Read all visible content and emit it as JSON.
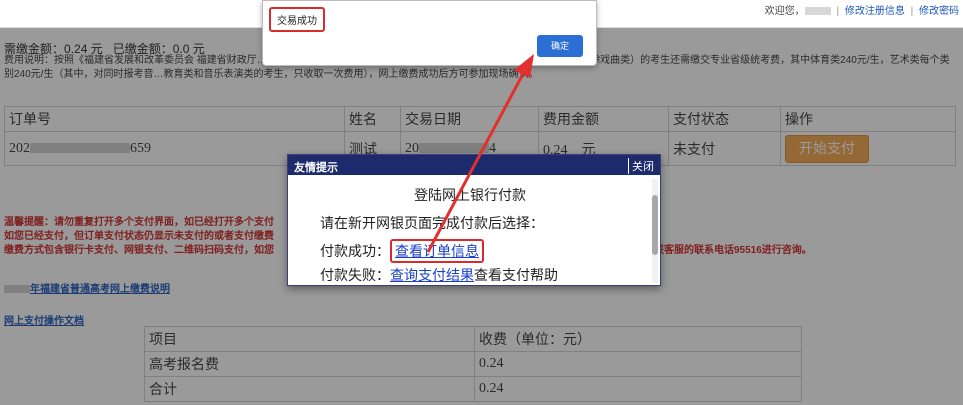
{
  "top": {
    "welcome": "欢迎您，",
    "link_modify_info": "修改注册信息",
    "link_modify_pwd": "修改密码"
  },
  "summary": {
    "due_label": "需缴金额：",
    "due_value": "0.24 元",
    "paid_label": "已缴金额：",
    "paid_value": "0.0 元"
  },
  "fee_note": "费用说明：按照《福建省发展和改革委员会 福建省财政厅……238号）规定，通过网络缴交报名考试费240元，报考体育类、艺术类（除戏曲类）的考生还需缴交专业省级统考费，其中体育类240元/生，艺术类每个类别240元/生（其中，对同时报考音…教育类和音乐表演类的考生，只收取一次费用），网上缴费成功后方可参加现场确认。",
  "orders": {
    "headers": [
      "订单号",
      "姓名",
      "交易日期",
      "费用金额",
      "支付状态",
      "操作"
    ],
    "row": {
      "order_prefix": "202",
      "order_suffix": "659",
      "name": "测试",
      "date_prefix": "20",
      "date_suffix": "4",
      "amount": "0.24",
      "unit": "元",
      "status": "未支付",
      "action": "开始支付"
    }
  },
  "warning": {
    "line1": "温馨提醒：请勿重复打开多个支付界面，如已经打开多个支付",
    "line2": "如您已经支付，但订单支付状态仍显示未支付的或者支付缴费",
    "line3": "缴费方式包含银行卡支付、网银支付、二维码扫码支付，如您",
    "line3_end": "码支付”或拨打银联客服的联系电话95516进行咨询。"
  },
  "links": {
    "notice": "年福建省普通高考网上缴费说明",
    "doc": "网上支付操作文档"
  },
  "fees": {
    "headers": [
      "项目",
      "收费（单位：元）"
    ],
    "rows": [
      [
        "高考报名费",
        "0.24"
      ],
      [
        "合计",
        "0.24"
      ]
    ]
  },
  "alert": {
    "message": "交易成功",
    "ok": "确定"
  },
  "friendly": {
    "title": "友情提示",
    "close": "关闭",
    "heading": "登陆网上银行付款",
    "line1": "请在新开网银页面完成付款后选择：",
    "success_label": "付款成功：",
    "success_link": "查看订单信息",
    "fail_label": "付款失败：",
    "fail_link": "查询支付结果",
    "fail_rest": "查看支付帮助"
  },
  "colors": {
    "highlight": "#d92b2b",
    "header_bg": "#1d2a6b",
    "ok_button": "#2b6fd6",
    "pay_button": "#f4a64a"
  }
}
